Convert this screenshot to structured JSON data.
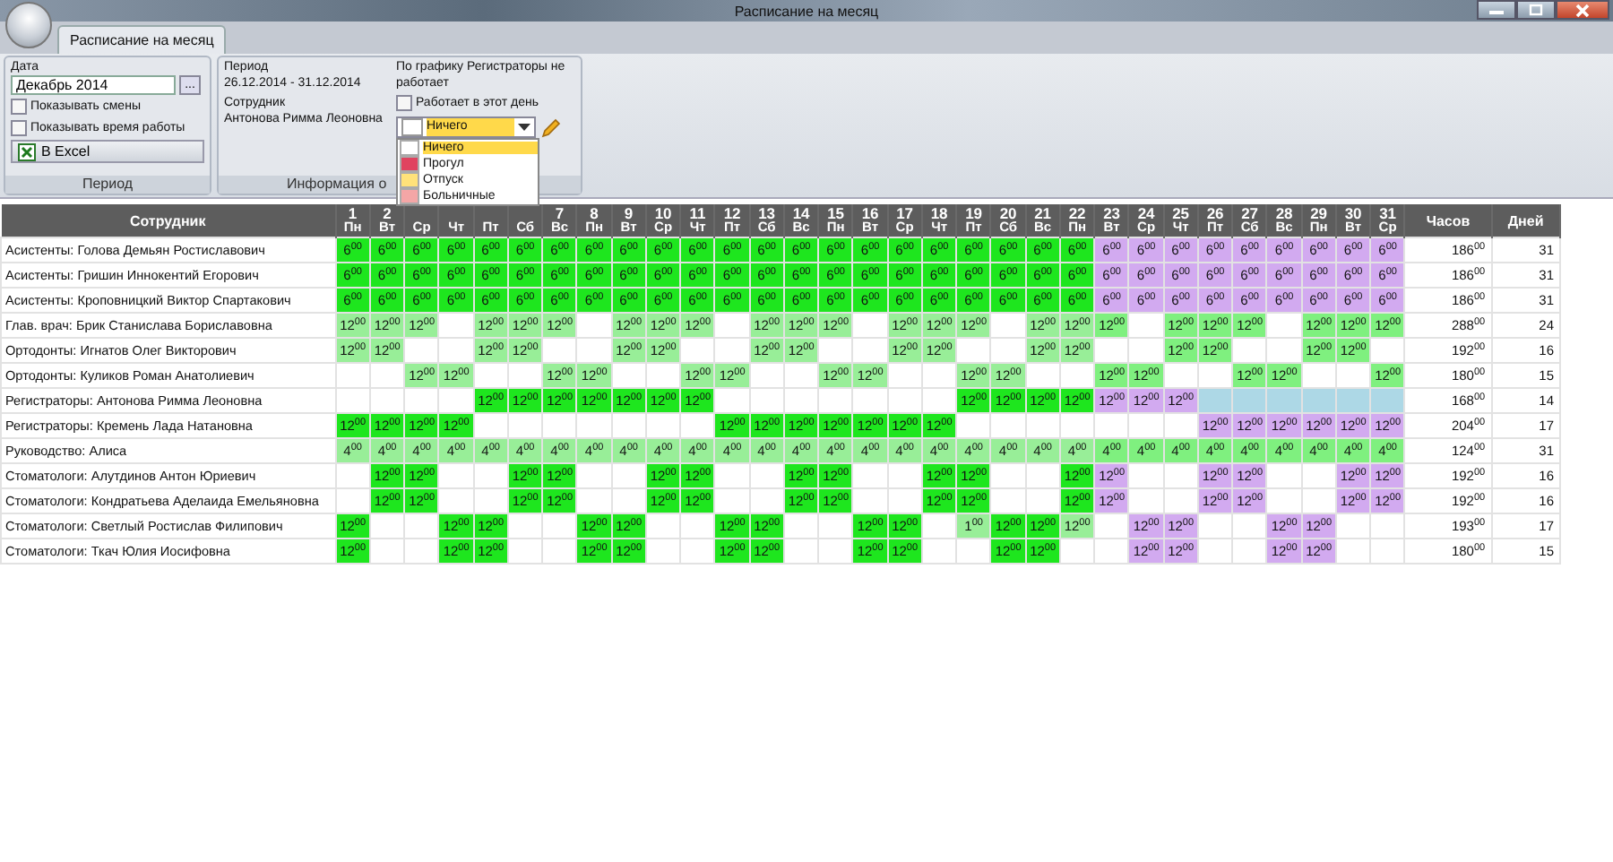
{
  "window": {
    "title": "Расписание на месяц"
  },
  "tabs": [
    {
      "label": "Расписание на месяц",
      "selected": true
    }
  ],
  "period_group": {
    "label": "Период",
    "date_label": "Дата",
    "date_value": "Декабрь 2014",
    "browse_button": "...",
    "checkboxes": [
      {
        "label": "Показывать смены",
        "checked": false
      },
      {
        "label": "Показывать время работы",
        "checked": false
      }
    ],
    "excel_button": "В Excel"
  },
  "info_group": {
    "label": "Информация о",
    "period_label": "Период",
    "period_value": "26.12.2014 - 31.12.2014",
    "employee_label": "Сотрудник",
    "employee_value": "Антонова Римма Леоновна",
    "schedule_note": "По графику Регистраторы не работает",
    "works_checkbox": {
      "label": "Работает в этот день",
      "checked": false
    },
    "combo": {
      "value": "Ничего",
      "color": "#ffffff"
    },
    "dropdown": [
      {
        "label": "Ничего",
        "color": "#ffffff",
        "selected": true
      },
      {
        "label": "Прогул",
        "color": "#e0435f",
        "selected": false
      },
      {
        "label": "Отпуск",
        "color": "#ffe27a",
        "selected": false
      },
      {
        "label": "Больничные",
        "color": "#f4a6a6",
        "selected": false
      }
    ]
  },
  "table": {
    "name_header": "Сотрудник",
    "hours_header": "Часов",
    "days_header": "Дней",
    "days": [
      {
        "day": "1",
        "weekday": "Пн"
      },
      {
        "day": "2",
        "weekday": "Вт"
      },
      {
        "weekday": "Ср"
      },
      {
        "weekday": "Чт"
      },
      {
        "weekday": "Пт"
      },
      {
        "weekday": "Сб"
      },
      {
        "day": "7",
        "weekday": "Вс"
      },
      {
        "day": "8",
        "weekday": "Пн"
      },
      {
        "day": "9",
        "weekday": "Вт"
      },
      {
        "day": "10",
        "weekday": "Ср"
      },
      {
        "day": "11",
        "weekday": "Чт"
      },
      {
        "day": "12",
        "weekday": "Пт"
      },
      {
        "day": "13",
        "weekday": "Сб"
      },
      {
        "day": "14",
        "weekday": "Вс"
      },
      {
        "day": "15",
        "weekday": "Пн"
      },
      {
        "day": "16",
        "weekday": "Вт"
      },
      {
        "day": "17",
        "weekday": "Ср"
      },
      {
        "day": "18",
        "weekday": "Чт"
      },
      {
        "day": "19",
        "weekday": "Пт"
      },
      {
        "day": "20",
        "weekday": "Сб"
      },
      {
        "day": "21",
        "weekday": "Вс"
      },
      {
        "day": "22",
        "weekday": "Пн"
      },
      {
        "day": "23",
        "weekday": "Вт"
      },
      {
        "day": "24",
        "weekday": "Ср"
      },
      {
        "day": "25",
        "weekday": "Чт"
      },
      {
        "day": "26",
        "weekday": "Пт"
      },
      {
        "day": "27",
        "weekday": "Сб"
      },
      {
        "day": "28",
        "weekday": "Вс"
      },
      {
        "day": "29",
        "weekday": "Пн"
      },
      {
        "day": "30",
        "weekday": "Вт"
      },
      {
        "day": "31",
        "weekday": "Ср"
      }
    ],
    "rows": [
      {
        "name": "Асистенты: Голова Демьян Ростиславович",
        "hours": "186$^{00}$",
        "days": "31",
        "cells": [
          {
            "text": "6$^{00}$",
            "color": "#1ee61e"
          },
          {
            "text": "6$^{00}$",
            "color": "#1ee61e"
          },
          {
            "text": "6$^{00}$",
            "color": "#1ee61e"
          },
          {
            "text": "6$^{00}$",
            "color": "#1ee61e"
          },
          {
            "text": "6$^{00}$",
            "color": "#1ee61e"
          },
          {
            "text": "6$^{00}$",
            "color": "#1ee61e"
          },
          {
            "text": "6$^{00}$",
            "color": "#1ee61e"
          },
          {
            "text": "6$^{00}$",
            "color": "#1ee61e"
          },
          {
            "text": "6$^{00}$",
            "color": "#1ee61e"
          },
          {
            "text": "6$^{00}$",
            "color": "#1ee61e"
          },
          {
            "text": "6$^{00}$",
            "color": "#1ee61e"
          },
          {
            "text": "6$^{00}$",
            "color": "#1ee61e"
          },
          {
            "text": "6$^{00}$",
            "color": "#1ee61e"
          },
          {
            "text": "6$^{00}$",
            "color": "#1ee61e"
          },
          {
            "text": "6$^{00}$",
            "color": "#1ee61e"
          },
          {
            "text": "6$^{00}$",
            "color": "#1ee61e"
          },
          {
            "text": "6$^{00}$",
            "color": "#1ee61e"
          },
          {
            "text": "6$^{00}$",
            "color": "#1ee61e"
          },
          {
            "text": "6$^{00}$",
            "color": "#1ee61e"
          },
          {
            "text": "6$^{00}$",
            "color": "#1ee61e"
          },
          {
            "text": "6$^{00}$",
            "color": "#1ee61e"
          },
          {
            "text": "6$^{00}$",
            "color": "#1ee61e"
          },
          {
            "text": "6$^{00}$",
            "color": "#d2aaf0"
          },
          {
            "text": "6$^{00}$",
            "color": "#d2aaf0"
          },
          {
            "text": "6$^{00}$",
            "color": "#d2aaf0"
          },
          {
            "text": "6$^{00}$",
            "color": "#d2aaf0"
          },
          {
            "text": "6$^{00}$",
            "color": "#d2aaf0"
          },
          {
            "text": "6$^{00}$",
            "color": "#d2aaf0"
          },
          {
            "text": "6$^{00}$",
            "color": "#d2aaf0"
          },
          {
            "text": "6$^{00}$",
            "color": "#d2aaf0"
          },
          {
            "text": "6$^{00}$",
            "color": "#d2aaf0"
          }
        ]
      },
      {
        "name": "Асистенты: Гришин Иннокентий Егорович",
        "hours": "186$^{00}$",
        "days": "31",
        "cells": [
          {
            "text": "6$^{00}$",
            "color": "#1ee61e"
          },
          {
            "text": "6$^{00}$",
            "color": "#1ee61e"
          },
          {
            "text": "6$^{00}$",
            "color": "#1ee61e"
          },
          {
            "text": "6$^{00}$",
            "color": "#1ee61e"
          },
          {
            "text": "6$^{00}$",
            "color": "#1ee61e"
          },
          {
            "text": "6$^{00}$",
            "color": "#1ee61e"
          },
          {
            "text": "6$^{00}$",
            "color": "#1ee61e"
          },
          {
            "text": "6$^{00}$",
            "color": "#1ee61e"
          },
          {
            "text": "6$^{00}$",
            "color": "#1ee61e"
          },
          {
            "text": "6$^{00}$",
            "color": "#1ee61e"
          },
          {
            "text": "6$^{00}$",
            "color": "#1ee61e"
          },
          {
            "text": "6$^{00}$",
            "color": "#1ee61e"
          },
          {
            "text": "6$^{00}$",
            "color": "#1ee61e"
          },
          {
            "text": "6$^{00}$",
            "color": "#1ee61e"
          },
          {
            "text": "6$^{00}$",
            "color": "#1ee61e"
          },
          {
            "text": "6$^{00}$",
            "color": "#1ee61e"
          },
          {
            "text": "6$^{00}$",
            "color": "#1ee61e"
          },
          {
            "text": "6$^{00}$",
            "color": "#1ee61e"
          },
          {
            "text": "6$^{00}$",
            "color": "#1ee61e"
          },
          {
            "text": "6$^{00}$",
            "color": "#1ee61e"
          },
          {
            "text": "6$^{00}$",
            "color": "#1ee61e"
          },
          {
            "text": "6$^{00}$",
            "color": "#1ee61e"
          },
          {
            "text": "6$^{00}$",
            "color": "#d2aaf0"
          },
          {
            "text": "6$^{00}$",
            "color": "#d2aaf0"
          },
          {
            "text": "6$^{00}$",
            "color": "#d2aaf0"
          },
          {
            "text": "6$^{00}$",
            "color": "#d2aaf0"
          },
          {
            "text": "6$^{00}$",
            "color": "#d2aaf0"
          },
          {
            "text": "6$^{00}$",
            "color": "#d2aaf0"
          },
          {
            "text": "6$^{00}$",
            "color": "#d2aaf0"
          },
          {
            "text": "6$^{00}$",
            "color": "#d2aaf0"
          },
          {
            "text": "6$^{00}$",
            "color": "#d2aaf0"
          }
        ]
      },
      {
        "name": "Асистенты: Кроповницкий Виктор Спартакович",
        "hours": "186$^{00}$",
        "days": "31",
        "cells": [
          {
            "text": "6$^{00}$",
            "color": "#1ee61e"
          },
          {
            "text": "6$^{00}$",
            "color": "#1ee61e"
          },
          {
            "text": "6$^{00}$",
            "color": "#1ee61e"
          },
          {
            "text": "6$^{00}$",
            "color": "#1ee61e"
          },
          {
            "text": "6$^{00}$",
            "color": "#1ee61e"
          },
          {
            "text": "6$^{00}$",
            "color": "#1ee61e"
          },
          {
            "text": "6$^{00}$",
            "color": "#1ee61e"
          },
          {
            "text": "6$^{00}$",
            "color": "#1ee61e"
          },
          {
            "text": "6$^{00}$",
            "color": "#1ee61e"
          },
          {
            "text": "6$^{00}$",
            "color": "#1ee61e"
          },
          {
            "text": "6$^{00}$",
            "color": "#1ee61e"
          },
          {
            "text": "6$^{00}$",
            "color": "#1ee61e"
          },
          {
            "text": "6$^{00}$",
            "color": "#1ee61e"
          },
          {
            "text": "6$^{00}$",
            "color": "#1ee61e"
          },
          {
            "text": "6$^{00}$",
            "color": "#1ee61e"
          },
          {
            "text": "6$^{00}$",
            "color": "#1ee61e"
          },
          {
            "text": "6$^{00}$",
            "color": "#1ee61e"
          },
          {
            "text": "6$^{00}$",
            "color": "#1ee61e"
          },
          {
            "text": "6$^{00}$",
            "color": "#1ee61e"
          },
          {
            "text": "6$^{00}$",
            "color": "#1ee61e"
          },
          {
            "text": "6$^{00}$",
            "color": "#1ee61e"
          },
          {
            "text": "6$^{00}$",
            "color": "#1ee61e"
          },
          {
            "text": "6$^{00}$",
            "color": "#d2aaf0"
          },
          {
            "text": "6$^{00}$",
            "color": "#d2aaf0"
          },
          {
            "text": "6$^{00}$",
            "color": "#d2aaf0"
          },
          {
            "text": "6$^{00}$",
            "color": "#d2aaf0"
          },
          {
            "text": "6$^{00}$",
            "color": "#d2aaf0"
          },
          {
            "text": "6$^{00}$",
            "color": "#d2aaf0"
          },
          {
            "text": "6$^{00}$",
            "color": "#d2aaf0"
          },
          {
            "text": "6$^{00}$",
            "color": "#d2aaf0"
          },
          {
            "text": "6$^{00}$",
            "color": "#d2aaf0"
          }
        ]
      },
      {
        "name": "Глав. врач: Брик Станислава Бориславовна",
        "hours": "288$^{00}$",
        "days": "24",
        "cells": [
          {
            "text": "12$^{00}$",
            "color": "#98ee98"
          },
          {
            "text": "12$^{00}$",
            "color": "#98ee98"
          },
          {
            "text": "12$^{00}$",
            "color": "#98ee98"
          },
          null,
          {
            "text": "12$^{00}$",
            "color": "#98ee98"
          },
          {
            "text": "12$^{00}$",
            "color": "#98ee98"
          },
          {
            "text": "12$^{00}$",
            "color": "#98ee98"
          },
          null,
          {
            "text": "12$^{00}$",
            "color": "#98ee98"
          },
          {
            "text": "12$^{00}$",
            "color": "#98ee98"
          },
          {
            "text": "12$^{00}$",
            "color": "#98ee98"
          },
          null,
          {
            "text": "12$^{00}$",
            "color": "#98ee98"
          },
          {
            "text": "12$^{00}$",
            "color": "#98ee98"
          },
          {
            "text": "12$^{00}$",
            "color": "#98ee98"
          },
          null,
          {
            "text": "12$^{00}$",
            "color": "#98ee98"
          },
          {
            "text": "12$^{00}$",
            "color": "#98ee98"
          },
          {
            "text": "12$^{00}$",
            "color": "#98ee98"
          },
          null,
          {
            "text": "12$^{00}$",
            "color": "#98ee98"
          },
          {
            "text": "12$^{00}$",
            "color": "#98ee98"
          },
          {
            "text": "12$^{00}$",
            "color": "#7ff07f"
          },
          null,
          {
            "text": "12$^{00}$",
            "color": "#7ff07f"
          },
          {
            "text": "12$^{00}$",
            "color": "#7ff07f"
          },
          {
            "text": "12$^{00}$",
            "color": "#7ff07f"
          },
          null,
          {
            "text": "12$^{00}$",
            "color": "#7ff07f"
          },
          {
            "text": "12$^{00}$",
            "color": "#7ff07f"
          },
          {
            "text": "12$^{00}$",
            "color": "#7ff07f"
          }
        ]
      },
      {
        "name": "Ортодонты: Игнатов Олег Викторович",
        "hours": "192$^{00}$",
        "days": "16",
        "cells": [
          {
            "text": "12$^{00}$",
            "color": "#98ee98"
          },
          {
            "text": "12$^{00}$",
            "color": "#98ee98"
          },
          null,
          null,
          {
            "text": "12$^{00}$",
            "color": "#98ee98"
          },
          {
            "text": "12$^{00}$",
            "color": "#98ee98"
          },
          null,
          null,
          {
            "text": "12$^{00}$",
            "color": "#98ee98"
          },
          {
            "text": "12$^{00}$",
            "color": "#98ee98"
          },
          null,
          null,
          {
            "text": "12$^{00}$",
            "color": "#98ee98"
          },
          {
            "text": "12$^{00}$",
            "color": "#98ee98"
          },
          null,
          null,
          {
            "text": "12$^{00}$",
            "color": "#98ee98"
          },
          {
            "text": "12$^{00}$",
            "color": "#98ee98"
          },
          null,
          null,
          {
            "text": "12$^{00}$",
            "color": "#98ee98"
          },
          {
            "text": "12$^{00}$",
            "color": "#98ee98"
          },
          null,
          null,
          {
            "text": "12$^{00}$",
            "color": "#7ff07f"
          },
          {
            "text": "12$^{00}$",
            "color": "#7ff07f"
          },
          null,
          null,
          {
            "text": "12$^{00}$",
            "color": "#7ff07f"
          },
          {
            "text": "12$^{00}$",
            "color": "#7ff07f"
          },
          null
        ]
      },
      {
        "name": "Ортодонты: Куликов Роман Анатолиевич",
        "hours": "180$^{00}$",
        "days": "15",
        "cells": [
          null,
          null,
          {
            "text": "12$^{00}$",
            "color": "#98ee98"
          },
          {
            "text": "12$^{00}$",
            "color": "#98ee98"
          },
          null,
          null,
          {
            "text": "12$^{00}$",
            "color": "#98ee98"
          },
          {
            "text": "12$^{00}$",
            "color": "#98ee98"
          },
          null,
          null,
          {
            "text": "12$^{00}$",
            "color": "#98ee98"
          },
          {
            "text": "12$^{00}$",
            "color": "#98ee98"
          },
          null,
          null,
          {
            "text": "12$^{00}$",
            "color": "#98ee98"
          },
          {
            "text": "12$^{00}$",
            "color": "#98ee98"
          },
          null,
          null,
          {
            "text": "12$^{00}$",
            "color": "#98ee98"
          },
          {
            "text": "12$^{00}$",
            "color": "#98ee98"
          },
          null,
          null,
          {
            "text": "12$^{00}$",
            "color": "#7ff07f"
          },
          {
            "text": "12$^{00}$",
            "color": "#7ff07f"
          },
          null,
          null,
          {
            "text": "12$^{00}$",
            "color": "#7ff07f"
          },
          {
            "text": "12$^{00}$",
            "color": "#7ff07f"
          },
          null,
          null,
          {
            "text": "12$^{00}$",
            "color": "#7ff07f"
          }
        ]
      },
      {
        "name": "Регистраторы: Антонова Римма Леоновна",
        "hours": "168$^{00}$",
        "days": "14",
        "cells": [
          null,
          null,
          null,
          null,
          {
            "text": "12$^{00}$",
            "color": "#1ee61e"
          },
          {
            "text": "12$^{00}$",
            "color": "#1ee61e"
          },
          {
            "text": "12$^{00}$",
            "color": "#1ee61e"
          },
          {
            "text": "12$^{00}$",
            "color": "#1ee61e"
          },
          {
            "text": "12$^{00}$",
            "color": "#1ee61e"
          },
          {
            "text": "12$^{00}$",
            "color": "#1ee61e"
          },
          {
            "text": "12$^{00}$",
            "color": "#1ee61e"
          },
          null,
          null,
          null,
          null,
          null,
          null,
          null,
          {
            "text": "12$^{00}$",
            "color": "#1ee61e"
          },
          {
            "text": "12$^{00}$",
            "color": "#1ee61e"
          },
          {
            "text": "12$^{00}$",
            "color": "#1ee61e"
          },
          {
            "text": "12$^{00}$",
            "color": "#1ee61e"
          },
          {
            "text": "12$^{00}$",
            "color": "#d2aaf0"
          },
          {
            "text": "12$^{00}$",
            "color": "#d2aaf0"
          },
          {
            "text": "12$^{00}$",
            "color": "#d2aaf0"
          },
          {
            "color": "#add8e6"
          },
          {
            "color": "#add8e6"
          },
          {
            "color": "#add8e6"
          },
          {
            "color": "#add8e6"
          },
          {
            "color": "#add8e6"
          },
          {
            "color": "#add8e6"
          }
        ]
      },
      {
        "name": "Регистраторы: Кремень Лада Натановна",
        "hours": "204$^{00}$",
        "days": "17",
        "cells": [
          {
            "text": "12$^{00}$",
            "color": "#1ee61e"
          },
          {
            "text": "12$^{00}$",
            "color": "#1ee61e"
          },
          {
            "text": "12$^{00}$",
            "color": "#1ee61e"
          },
          {
            "text": "12$^{00}$",
            "color": "#1ee61e"
          },
          null,
          null,
          null,
          null,
          null,
          null,
          null,
          {
            "text": "12$^{00}$",
            "color": "#1ee61e"
          },
          {
            "text": "12$^{00}$",
            "color": "#1ee61e"
          },
          {
            "text": "12$^{00}$",
            "color": "#1ee61e"
          },
          {
            "text": "12$^{00}$",
            "color": "#1ee61e"
          },
          {
            "text": "12$^{00}$",
            "color": "#1ee61e"
          },
          {
            "text": "12$^{00}$",
            "color": "#1ee61e"
          },
          {
            "text": "12$^{00}$",
            "color": "#1ee61e"
          },
          null,
          null,
          null,
          null,
          null,
          null,
          null,
          {
            "text": "12$^{00}$",
            "color": "#d2aaf0"
          },
          {
            "text": "12$^{00}$",
            "color": "#d2aaf0"
          },
          {
            "text": "12$^{00}$",
            "color": "#d2aaf0"
          },
          {
            "text": "12$^{00}$",
            "color": "#d2aaf0"
          },
          {
            "text": "12$^{00}$",
            "color": "#d2aaf0"
          },
          {
            "text": "12$^{00}$",
            "color": "#d2aaf0"
          }
        ]
      },
      {
        "name": "Руководство: Алиса",
        "hours": "124$^{00}$",
        "days": "31",
        "cells": [
          {
            "text": "4$^{00}$",
            "color": "#98ee98"
          },
          {
            "text": "4$^{00}$",
            "color": "#98ee98"
          },
          {
            "text": "4$^{00}$",
            "color": "#98ee98"
          },
          {
            "text": "4$^{00}$",
            "color": "#98ee98"
          },
          {
            "text": "4$^{00}$",
            "color": "#98ee98"
          },
          {
            "text": "4$^{00}$",
            "color": "#98ee98"
          },
          {
            "text": "4$^{00}$",
            "color": "#98ee98"
          },
          {
            "text": "4$^{00}$",
            "color": "#98ee98"
          },
          {
            "text": "4$^{00}$",
            "color": "#98ee98"
          },
          {
            "text": "4$^{00}$",
            "color": "#98ee98"
          },
          {
            "text": "4$^{00}$",
            "color": "#98ee98"
          },
          {
            "text": "4$^{00}$",
            "color": "#98ee98"
          },
          {
            "text": "4$^{00}$",
            "color": "#98ee98"
          },
          {
            "text": "4$^{00}$",
            "color": "#98ee98"
          },
          {
            "text": "4$^{00}$",
            "color": "#98ee98"
          },
          {
            "text": "4$^{00}$",
            "color": "#98ee98"
          },
          {
            "text": "4$^{00}$",
            "color": "#98ee98"
          },
          {
            "text": "4$^{00}$",
            "color": "#98ee98"
          },
          {
            "text": "4$^{00}$",
            "color": "#98ee98"
          },
          {
            "text": "4$^{00}$",
            "color": "#98ee98"
          },
          {
            "text": "4$^{00}$",
            "color": "#98ee98"
          },
          {
            "text": "4$^{00}$",
            "color": "#98ee98"
          },
          {
            "text": "4$^{00}$",
            "color": "#7ff07f"
          },
          {
            "text": "4$^{00}$",
            "color": "#7ff07f"
          },
          {
            "text": "4$^{00}$",
            "color": "#7ff07f"
          },
          {
            "text": "4$^{00}$",
            "color": "#7ff07f"
          },
          {
            "text": "4$^{00}$",
            "color": "#7ff07f"
          },
          {
            "text": "4$^{00}$",
            "color": "#7ff07f"
          },
          {
            "text": "4$^{00}$",
            "color": "#7ff07f"
          },
          {
            "text": "4$^{00}$",
            "color": "#7ff07f"
          },
          {
            "text": "4$^{00}$",
            "color": "#7ff07f"
          }
        ]
      },
      {
        "name": "Стоматологи: Алутдинов Антон Юриевич",
        "hours": "192$^{00}$",
        "days": "16",
        "cells": [
          null,
          {
            "text": "12$^{00}$",
            "color": "#1ee61e"
          },
          {
            "text": "12$^{00}$",
            "color": "#1ee61e"
          },
          null,
          null,
          {
            "text": "12$^{00}$",
            "color": "#1ee61e"
          },
          {
            "text": "12$^{00}$",
            "color": "#1ee61e"
          },
          null,
          null,
          {
            "text": "12$^{00}$",
            "color": "#1ee61e"
          },
          {
            "text": "12$^{00}$",
            "color": "#1ee61e"
          },
          null,
          null,
          {
            "text": "12$^{00}$",
            "color": "#1ee61e"
          },
          {
            "text": "12$^{00}$",
            "color": "#1ee61e"
          },
          null,
          null,
          {
            "text": "12$^{00}$",
            "color": "#1ee61e"
          },
          {
            "text": "12$^{00}$",
            "color": "#1ee61e"
          },
          null,
          null,
          {
            "text": "12$^{00}$",
            "color": "#1ee61e"
          },
          {
            "text": "12$^{00}$",
            "color": "#d2aaf0"
          },
          null,
          null,
          {
            "text": "12$^{00}$",
            "color": "#d2aaf0"
          },
          {
            "text": "12$^{00}$",
            "color": "#d2aaf0"
          },
          null,
          null,
          {
            "text": "12$^{00}$",
            "color": "#d2aaf0"
          },
          {
            "text": "12$^{00}$",
            "color": "#d2aaf0"
          }
        ]
      },
      {
        "name": "Стоматологи: Кондратьева Аделаида Емельяновна",
        "hours": "192$^{00}$",
        "days": "16",
        "cells": [
          null,
          {
            "text": "12$^{00}$",
            "color": "#1ee61e"
          },
          {
            "text": "12$^{00}$",
            "color": "#1ee61e"
          },
          null,
          null,
          {
            "text": "12$^{00}$",
            "color": "#1ee61e"
          },
          {
            "text": "12$^{00}$",
            "color": "#1ee61e"
          },
          null,
          null,
          {
            "text": "12$^{00}$",
            "color": "#1ee61e"
          },
          {
            "text": "12$^{00}$",
            "color": "#1ee61e"
          },
          null,
          null,
          {
            "text": "12$^{00}$",
            "color": "#1ee61e"
          },
          {
            "text": "12$^{00}$",
            "color": "#1ee61e"
          },
          null,
          null,
          {
            "text": "12$^{00}$",
            "color": "#1ee61e"
          },
          {
            "text": "12$^{00}$",
            "color": "#1ee61e"
          },
          null,
          null,
          {
            "text": "12$^{00}$",
            "color": "#1ee61e"
          },
          {
            "text": "12$^{00}$",
            "color": "#d2aaf0"
          },
          null,
          null,
          {
            "text": "12$^{00}$",
            "color": "#d2aaf0"
          },
          {
            "text": "12$^{00}$",
            "color": "#d2aaf0"
          },
          null,
          null,
          {
            "text": "12$^{00}$",
            "color": "#d2aaf0"
          },
          {
            "text": "12$^{00}$",
            "color": "#d2aaf0"
          }
        ]
      },
      {
        "name": "Стоматологи: Светлый Ростислав Филипович",
        "hours": "193$^{00}$",
        "days": "17",
        "cells": [
          {
            "text": "12$^{00}$",
            "color": "#1ee61e"
          },
          null,
          null,
          {
            "text": "12$^{00}$",
            "color": "#1ee61e"
          },
          {
            "text": "12$^{00}$",
            "color": "#1ee61e"
          },
          null,
          null,
          {
            "text": "12$^{00}$",
            "color": "#1ee61e"
          },
          {
            "text": "12$^{00}$",
            "color": "#1ee61e"
          },
          null,
          null,
          {
            "text": "12$^{00}$",
            "color": "#1ee61e"
          },
          {
            "text": "12$^{00}$",
            "color": "#1ee61e"
          },
          null,
          null,
          {
            "text": "12$^{00}$",
            "color": "#1ee61e"
          },
          {
            "text": "12$^{00}$",
            "color": "#1ee61e"
          },
          null,
          {
            "text": "1$^{00}$",
            "color": "#98ee98"
          },
          {
            "text": "12$^{00}$",
            "color": "#1ee61e"
          },
          {
            "text": "12$^{00}$",
            "color": "#1ee61e"
          },
          {
            "text": "12$^{00}$",
            "color": "#98ee98"
          },
          null,
          {
            "text": "12$^{00}$",
            "color": "#d2aaf0"
          },
          {
            "text": "12$^{00}$",
            "color": "#d2aaf0"
          },
          null,
          null,
          {
            "text": "12$^{00}$",
            "color": "#d2aaf0"
          },
          {
            "text": "12$^{00}$",
            "color": "#d2aaf0"
          },
          null,
          null
        ]
      },
      {
        "name": "Стоматологи: Ткач Юлия Иосифовна",
        "hours": "180$^{00}$",
        "days": "15",
        "cells": [
          {
            "text": "12$^{00}$",
            "color": "#1ee61e"
          },
          null,
          null,
          {
            "text": "12$^{00}$",
            "color": "#1ee61e"
          },
          {
            "text": "12$^{00}$",
            "color": "#1ee61e"
          },
          null,
          null,
          {
            "text": "12$^{00}$",
            "color": "#1ee61e"
          },
          {
            "text": "12$^{00}$",
            "color": "#1ee61e"
          },
          null,
          null,
          {
            "text": "12$^{00}$",
            "color": "#1ee61e"
          },
          {
            "text": "12$^{00}$",
            "color": "#1ee61e"
          },
          null,
          null,
          {
            "text": "12$^{00}$",
            "color": "#1ee61e"
          },
          {
            "text": "12$^{00}$",
            "color": "#1ee61e"
          },
          null,
          null,
          {
            "text": "12$^{00}$",
            "color": "#1ee61e"
          },
          {
            "text": "12$^{00}$",
            "color": "#1ee61e"
          },
          null,
          null,
          {
            "text": "12$^{00}$",
            "color": "#d2aaf0"
          },
          {
            "text": "12$^{00}$",
            "color": "#d2aaf0"
          },
          null,
          null,
          {
            "text": "12$^{00}$",
            "color": "#d2aaf0"
          },
          {
            "text": "12$^{00}$",
            "color": "#d2aaf0"
          },
          null,
          null
        ]
      }
    ]
  }
}
